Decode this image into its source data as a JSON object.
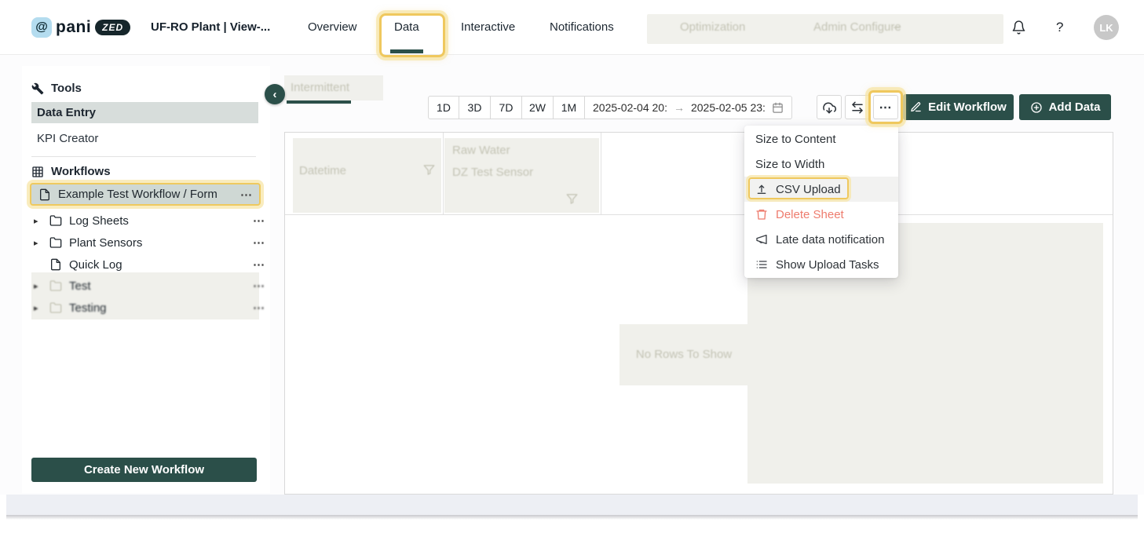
{
  "colors": {
    "accent_teal": "#2b4f49",
    "highlight_yellow": "#efc85e",
    "danger_red": "#ee7c6e",
    "skeleton_gray": "#f0f0eb",
    "selected_row_gray": "#d7dddb"
  },
  "ui": {
    "caret": "▸",
    "ellipsis": "⋯",
    "collapse": "‹",
    "dots": "⋯",
    "dash": "–",
    "date_arrow": "→"
  },
  "header": {
    "logo_at": "@",
    "logo_text": "pani",
    "logo_badge": "ZED",
    "plant_title": "UF-RO Plant | View-...",
    "nav": [
      {
        "label": "Overview"
      },
      {
        "label": "Data",
        "active": true,
        "tour_highlighted": true
      },
      {
        "label": "Interactive"
      },
      {
        "label": "Notifications"
      }
    ],
    "nav_disabled": [
      {
        "label": "Optimization"
      },
      {
        "label": "Admin Configure"
      }
    ],
    "help": "?",
    "avatar": "LK"
  },
  "sidebar": {
    "tools_title": "Tools",
    "tools_items": [
      {
        "label": "Data Entry",
        "selected": true
      },
      {
        "label": "KPI Creator"
      }
    ],
    "workflows_title": "Workflows",
    "workflow_items": [
      {
        "label": "Example Test Workflow / Form",
        "type": "doc",
        "tour_highlighted": true
      },
      {
        "label": "Log Sheets",
        "type": "folder",
        "expandable": true
      },
      {
        "label": "Plant Sensors",
        "type": "folder",
        "expandable": true
      },
      {
        "label": "Quick Log",
        "type": "doc"
      },
      {
        "label": "Test",
        "type": "folder",
        "expandable": true,
        "disabled": true
      },
      {
        "label": "Testing",
        "type": "folder",
        "expandable": true,
        "disabled": true
      }
    ],
    "create_label": "Create New Workflow"
  },
  "main": {
    "tab_label": "Intermittent",
    "range": [
      "1D",
      "3D",
      "7D",
      "2W",
      "1M"
    ],
    "date_start": "2025-02-04 20:",
    "date_end": "2025-02-05 23:",
    "edit_label": "Edit Workflow",
    "add_label": "Add Data",
    "menu": {
      "items": [
        {
          "label": "Size to Content"
        },
        {
          "label": "Size to Width"
        },
        {
          "label": "CSV Upload",
          "icon": "upload",
          "tour_highlighted": true
        },
        {
          "label": "Delete Sheet",
          "icon": "trash",
          "danger": true
        },
        {
          "label": "Late data notification",
          "icon": "megaphone"
        },
        {
          "label": "Show Upload Tasks",
          "icon": "list"
        }
      ]
    },
    "table": {
      "col1": "Datetime",
      "col2_line1": "Raw Water",
      "col2_line2": "DZ Test Sensor",
      "empty_message": "No Rows To Show"
    }
  }
}
